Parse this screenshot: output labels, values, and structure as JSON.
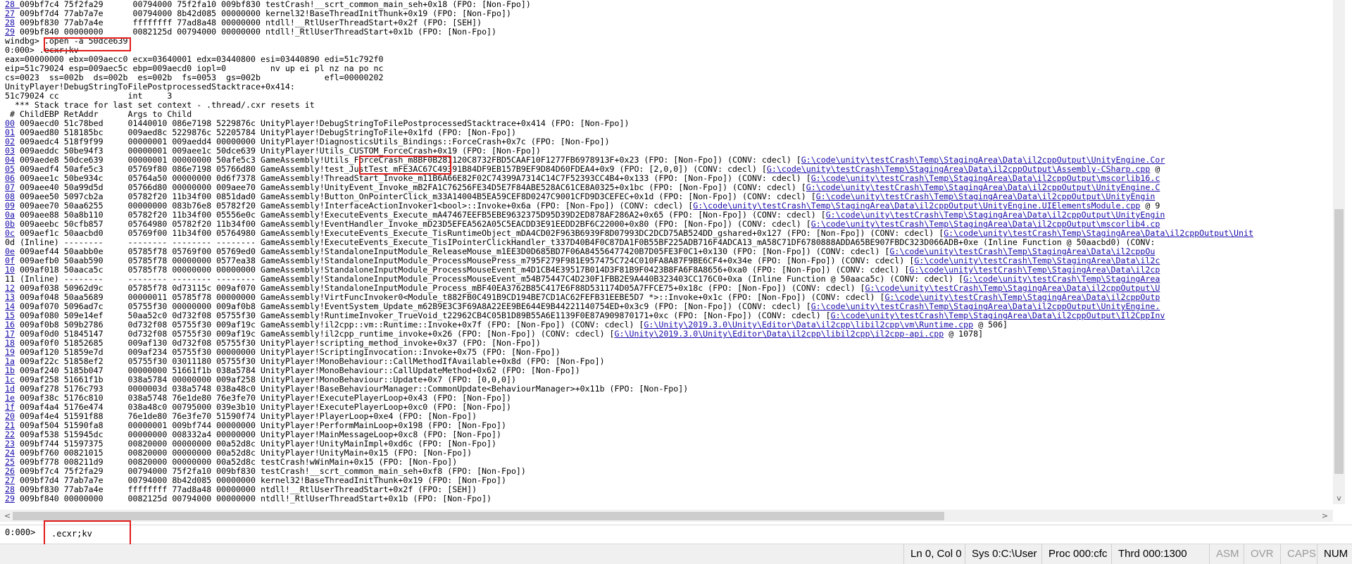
{
  "output_lines": [
    [
      {
        "t": "28 ",
        "l": true
      },
      {
        "t": "009bf7c4 75f2fa29      00794000 75f2fa10 009bf830 testCrash!__scrt_common_main_seh+0x18 (FPO: [Non-Fpo])"
      }
    ],
    [
      {
        "t": "27",
        "l": true
      },
      {
        "t": " 009bf7d4 77ab7a7e      00794000 8b42d085 00000000 kernel32!BaseThreadInitThunk+0x19 (FPO: [Non-Fpo])"
      }
    ],
    [
      {
        "t": "28",
        "l": true
      },
      {
        "t": " 009bf830 77ab7a4e      ffffffff 77ad8a48 00000000 ntdll!__RtlUserThreadStart+0x2f (FPO: [SEH])"
      }
    ],
    [
      {
        "t": "29",
        "l": true
      },
      {
        "t": " 009bf840 00000000      0082125d 00794000 00000000 ntdll!_RtlUserThreadStart+0x1b (FPO: [Non-Fpo])"
      }
    ],
    [
      {
        "t": "windbg> .open -a 50dce639"
      }
    ],
    [
      {
        "t": "0:000> .ecxr;kv"
      }
    ],
    [
      {
        "t": "eax=00000000 ebx=009aecc0 ecx=03640001 edx=03440800 esi=03440890 edi=51c792f0"
      }
    ],
    [
      {
        "t": "eip=51c79024 esp=009aec5c ebp=009aecd0 iopl=0         nv up ei pl nz na po nc"
      }
    ],
    [
      {
        "t": "cs=0023  ss=002b  ds=002b  es=002b  fs=0053  gs=002b             efl=00000202"
      }
    ],
    [
      {
        "t": "UnityPlayer!DebugStringToFilePostprocessedStacktrace+0x414:"
      }
    ],
    [
      {
        "t": "51c79024 cc              int     3"
      }
    ],
    [
      {
        "t": "  *** Stack trace for last set context - .thread/.cxr resets it"
      }
    ],
    [
      {
        "t": " # ChildEBP RetAddr      Args to Child"
      }
    ],
    [
      {
        "t": "00",
        "l": true
      },
      {
        "t": " 009aecd0 51c78bed     01440010 086e7198 5229876c UnityPlayer!DebugStringToFilePostprocessedStacktrace+0x414 (FPO: [Non-Fpo])"
      }
    ],
    [
      {
        "t": "01",
        "l": true
      },
      {
        "t": " 009aed80 518185bc     009aed8c 5229876c 52205784 UnityPlayer!DebugStringToFile+0x1fd (FPO: [Non-Fpo])"
      }
    ],
    [
      {
        "t": "02",
        "l": true
      },
      {
        "t": " 009aedc4 518f9f99     00000001 009aedd4 00000000 UnityPlayer!DiagnosticsUtils_Bindings::ForceCrash+0x7c (FPO: [Non-Fpo])"
      }
    ],
    [
      {
        "t": "03",
        "l": true
      },
      {
        "t": " 009aeddc 50be94f3     00000001 009aee1c 50dce639 UnityPlayer!Utils_CUSTOM_ForceCrash+0x19 (FPO: [Non-Fpo])"
      }
    ],
    [
      {
        "t": "04",
        "l": true
      },
      {
        "t": " 009aede8 50dce639     00000001 00000000 50afe5c3 GameAssembly!Utils_ForceCrash_m8BF0B281120C8732FBD5CAAF10F1277FB6978913F+0x23 (FPO: [Non-Fpo]) (CONV: cdecl) ["
      },
      {
        "t": "G:\\code\\unity\\testCrash\\Temp\\StagingArea\\Data\\il2cppOutput\\UnityEngine.Cor",
        "l": true
      }
    ],
    [
      {
        "t": "05",
        "l": true
      },
      {
        "t": " 009aedf4 50afe5c3     05769f80 086e7198 05766d80 GameAssembly!test_JustTest_mFE3AC67C49391B84DF9EB157B9EF9D84D60FDEA4+0x9 (FPO: [2,0,0]) (CONV: cdecl) ["
      },
      {
        "t": "G:\\code\\unity\\testCrash\\Temp\\StagingArea\\Data\\il2cppOutput\\Assembly-CSharp.cpp",
        "l": true
      },
      {
        "t": " @"
      }
    ],
    [
      {
        "t": "06",
        "l": true
      },
      {
        "t": " 009aee1c 50be934c     05764a50 00000000 0d6f7378 GameAssembly!ThreadStart_Invoke_m11B6A66E82F02C74399A7314C14C7F52393CC4B4+0x133 (FPO: [Non-Fpo]) (CONV: cdecl) ["
      },
      {
        "t": "G:\\code\\unity\\testCrash\\Temp\\StagingArea\\Data\\il2cppOutput\\mscorlib16.c",
        "l": true
      }
    ],
    [
      {
        "t": "07",
        "l": true
      },
      {
        "t": " 009aee40 50a99d5d     05766d80 00000000 009aee70 GameAssembly!UnityEvent_Invoke_mB2FA1C76256FE34D5E7F84ABE528AC61CE8A0325+0x1bc (FPO: [Non-Fpo]) (CONV: cdecl) ["
      },
      {
        "t": "G:\\code\\unity\\testCrash\\Temp\\StagingArea\\Data\\il2cppOutput\\UnityEngine.C",
        "l": true
      }
    ],
    [
      {
        "t": "08",
        "l": true
      },
      {
        "t": " 009aee50 5097cb2a     05782f20 11b34f00 0851dad0 GameAssembly!Button_OnPointerClick_m33A14004B5EA59CEF8D0247C9001CFD9D3CEFEC+0x1d (FPO: [Non-Fpo]) (CONV: cdecl) ["
      },
      {
        "t": "G:\\code\\unity\\testCrash\\Temp\\StagingArea\\Data\\il2cppOutput\\UnityEngin",
        "l": true
      }
    ],
    [
      {
        "t": "09",
        "l": true
      },
      {
        "t": " 009aee70 50aa6255     00000000 083b76e8 05782f20 GameAssembly!InterfaceActionInvoker1<bool>::Invoke+0x6a (FPO: [Non-Fpo]) (CONV: cdecl) ["
      },
      {
        "t": "G:\\code\\unity\\testCrash\\Temp\\StagingArea\\Data\\il2cppOutput\\UnityEngine.UIElementsModule.cpp",
        "l": true
      },
      {
        "t": " @ 9"
      }
    ],
    [
      {
        "t": "0a",
        "l": true
      },
      {
        "t": " 009aee88 50a8b110     05782f20 11b34f00 05556e0c GameAssembly!ExecuteEvents_Execute_mA47467EEFB5EBE9632375D95D39D2ED878AF286A2+0x65 (FPO: [Non-Fpo]) (CONV: cdecl) ["
      },
      {
        "t": "G:\\code\\unity\\testCrash\\Temp\\StagingArea\\Data\\il2cppOutput\\UnityEngin",
        "l": true
      }
    ],
    [
      {
        "t": "0b",
        "l": true
      },
      {
        "t": " 009aeebc 50cfb857     05764980 05782f20 11b34f00 GameAssembly!EventHandler_Invoke_mD23D5EFEA562A05C5EACDD3E91EEDD2BF6C22000+0x80 (FPO: [Non-Fpo]) (CONV: cdecl) ["
      },
      {
        "t": "G:\\code\\unity\\testCrash\\Temp\\StagingArea\\Data\\il2cppOutput\\mscorlib4.cp",
        "l": true
      }
    ],
    [
      {
        "t": "0c",
        "l": true
      },
      {
        "t": " 009aef1c 50aacbd0     05769f00 11b34f00 05764980 GameAssembly!ExecuteEvents_Execute_TisRuntimeObject_mDA4CD02F963B6939F8D07993DC2DCD75AB524DD_gshared+0x127 (FPO: [Non-Fpo]) (CONV: cdecl) ["
      },
      {
        "t": "G:\\code\\unity\\testCrash\\Temp\\StagingArea\\Data\\il2cppOutput\\Unit",
        "l": true
      }
    ],
    [
      {
        "t": "0d (Inline) --------     -------- -------- -------- GameAssembly!ExecuteEvents_Execute_TisIPointerClickHandler_t337D40B4F0C87DA1F0B55BF225ADB716F4ADCA13_mA58C71DF6780888ADDA65BE907FBDC323D066ADB+0xe (Inline Function @ 50aacbd0) (CONV:"
      }
    ],
    [
      {
        "t": "0e",
        "l": true
      },
      {
        "t": " 009aef44 50aabb0e     05785f78 05769f00 05769ed0 GameAssembly!StandaloneInputModule_ReleaseMouse_m1EE3D0D685BD7F06A84556477420B7D05FE3F0C1+0x130 (FPO: [Non-Fpo]) (CONV: cdecl) ["
      },
      {
        "t": "G:\\code\\unity\\testCrash\\Temp\\StagingArea\\Data\\il2cppOu",
        "l": true
      }
    ],
    [
      {
        "t": "0f",
        "l": true
      },
      {
        "t": " 009aefb0 50aab590     05785f78 00000000 0577ea38 GameAssembly!StandaloneInputModule_ProcessMousePress_m795F279F981E957475C724C010FA8A87F9BE6CF4+0x34e (FPO: [Non-Fpo]) (CONV: cdecl) ["
      },
      {
        "t": "G:\\code\\unity\\testCrash\\Temp\\StagingArea\\Data\\il2c",
        "l": true
      }
    ],
    [
      {
        "t": "10",
        "l": true
      },
      {
        "t": " 009af018 50aaca5c     05785f78 00000000 00000000 GameAssembly!StandaloneInputModule_ProcessMouseEvent_m4D1CB4E39517B014D3F81B9F0423B8FA6F8A8656+0xa0 (FPO: [Non-Fpo]) (CONV: cdecl) ["
      },
      {
        "t": "G:\\code\\unity\\testCrash\\Temp\\StagingArea\\Data\\il2cp",
        "l": true
      }
    ],
    [
      {
        "t": "11 (Inline) --------     -------- -------- -------- GameAssembly!StandaloneInputModule_ProcessMouseEvent_m54B75447C4D230F1FBB2E9A440B323403CC176C0+0xa (Inline Function @ 50aaca5c) (CONV: cdecl) ["
      },
      {
        "t": "G:\\code\\unity\\testCrash\\Temp\\StagingArea",
        "l": true
      }
    ],
    [
      {
        "t": "12",
        "l": true
      },
      {
        "t": " 009af038 50962d9c     05785f78 0d73115c 009af070 GameAssembly!StandaloneInputModule_Process_mBF40EA3762B85C417E6F88D531174D05A7FFCE75+0x18c (FPO: [Non-Fpo]) (CONV: cdecl) ["
      },
      {
        "t": "G:\\code\\unity\\testCrash\\Temp\\StagingArea\\Data\\il2cppOutput\\U",
        "l": true
      }
    ],
    [
      {
        "t": "13",
        "l": true
      },
      {
        "t": " 009af048 50aa5689     00000011 05785f78 00000000 GameAssembly!VirtFuncInvoker0<Module_t882FB0C491B9CD194BE7CD1AC62FEFB31EEBE5D7 *>::Invoke+0x1c (FPO: [Non-Fpo]) (CONV: cdecl) ["
      },
      {
        "t": "G:\\code\\unity\\testCrash\\Temp\\StagingArea\\Data\\il2cppOutp",
        "l": true
      }
    ],
    [
      {
        "t": "14",
        "l": true
      },
      {
        "t": " 009af070 5096ad7c     05755f30 00000000 009af0b8 GameAssembly!EventSystem_Update_m62B9E3C3F69A8A22EE9BE644E9B44221140754ED+0x3c9 (FPO: [Non-Fpo]) (CONV: cdecl) ["
      },
      {
        "t": "G:\\code\\unity\\testCrash\\Temp\\StagingArea\\Data\\il2cppOutput\\UnityEngine.",
        "l": true
      }
    ],
    [
      {
        "t": "15",
        "l": true
      },
      {
        "t": " 009af080 509e14ef     50aa52c0 0d732f08 05755f30 GameAssembly!RuntimeInvoker_TrueVoid_t22962CB4C05B1D89B55A6E1139F0E87A909870171+0xc (FPO: [Non-Fpo]) (CONV: cdecl) ["
      },
      {
        "t": "G:\\code\\unity\\testCrash\\Temp\\StagingArea\\Data\\il2cppOutput\\Il2CppInv",
        "l": true
      }
    ],
    [
      {
        "t": "16",
        "l": true
      },
      {
        "t": " 009af0b8 509b2786     0d732f08 05755f30 009af19c GameAssembly!il2cpp::vm::Runtime::Invoke+0x7f (FPO: [Non-Fpo]) (CONV: cdecl) ["
      },
      {
        "t": "G:\\Unity\\2019.3.0\\Unity\\Editor\\Data\\il2cpp\\libil2cpp\\vm\\Runtime.cpp",
        "l": true
      },
      {
        "t": " @ 506]"
      }
    ],
    [
      {
        "t": "17",
        "l": true
      },
      {
        "t": " 009af0d0 51845147     0d732f08 05755f30 009af19c GameAssembly!il2cpp_runtime_invoke+0x26 (FPO: [Non-Fpo]) (CONV: cdecl) ["
      },
      {
        "t": "G:\\Unity\\2019.3.0\\Unity\\Editor\\Data\\il2cpp\\libil2cpp\\il2cpp-api.cpp",
        "l": true
      },
      {
        "t": " @ 1078]"
      }
    ],
    [
      {
        "t": "18",
        "l": true
      },
      {
        "t": " 009af0f0 51852685     009af130 0d732f08 05755f30 UnityPlayer!scripting_method_invoke+0x37 (FPO: [Non-Fpo])"
      }
    ],
    [
      {
        "t": "19",
        "l": true
      },
      {
        "t": " 009af120 51859e7d     009af234 05755f30 00000000 UnityPlayer!ScriptingInvocation::Invoke+0x75 (FPO: [Non-Fpo])"
      }
    ],
    [
      {
        "t": "1a",
        "l": true
      },
      {
        "t": " 009af22c 51858ef2     05755f30 03011180 05755f30 UnityPlayer!MonoBehaviour::CallMethodIfAvailable+0x8d (FPO: [Non-Fpo])"
      }
    ],
    [
      {
        "t": "1b",
        "l": true
      },
      {
        "t": " 009af240 5185b047     00000000 51661f1b 038a5784 UnityPlayer!MonoBehaviour::CallUpdateMethod+0x62 (FPO: [Non-Fpo])"
      }
    ],
    [
      {
        "t": "1c",
        "l": true
      },
      {
        "t": " 009af258 51661f1b     038a5784 00000000 009af258 UnityPlayer!MonoBehaviour::Update+0x7 (FPO: [0,0,0])"
      }
    ],
    [
      {
        "t": "1d",
        "l": true
      },
      {
        "t": " 009af278 5176c793     0000003d 038a5748 038a48c0 UnityPlayer!BaseBehaviourManager::CommonUpdate<BehaviourManager>+0x11b (FPO: [Non-Fpo])"
      }
    ],
    [
      {
        "t": "1e",
        "l": true
      },
      {
        "t": " 009af38c 5176c810     038a5748 76e1de80 76e3fe70 UnityPlayer!ExecutePlayerLoop+0x43 (FPO: [Non-Fpo])"
      }
    ],
    [
      {
        "t": "1f",
        "l": true
      },
      {
        "t": " 009af4a4 5176e474     038a48c0 00795000 039e3b10 UnityPlayer!ExecutePlayerLoop+0xc0 (FPO: [Non-Fpo])"
      }
    ],
    [
      {
        "t": "20",
        "l": true
      },
      {
        "t": " 009af4e4 51591f88     76e1de80 76e3fe70 51590f74 UnityPlayer!PlayerLoop+0xe4 (FPO: [Non-Fpo])"
      }
    ],
    [
      {
        "t": "21",
        "l": true
      },
      {
        "t": " 009af504 51590fa8     00000001 009bf744 00000000 UnityPlayer!PerformMainLoop+0x198 (FPO: [Non-Fpo])"
      }
    ],
    [
      {
        "t": "22",
        "l": true
      },
      {
        "t": " 009af538 515945dc     00000000 008332a4 00000000 UnityPlayer!MainMessageLoop+0xc8 (FPO: [Non-Fpo])"
      }
    ],
    [
      {
        "t": "23",
        "l": true
      },
      {
        "t": " 009bf744 51597375     00820000 00000000 00a52d8c UnityPlayer!UnityMainImpl+0xd6c (FPO: [Non-Fpo])"
      }
    ],
    [
      {
        "t": "24",
        "l": true
      },
      {
        "t": " 009bf760 00821015     00820000 00000000 00a52d8c UnityPlayer!UnityMain+0x15 (FPO: [Non-Fpo])"
      }
    ],
    [
      {
        "t": "25",
        "l": true
      },
      {
        "t": " 009bf778 008211d9     00820000 00000000 00a52d8c testCrash!wWinMain+0x15 (FPO: [Non-Fpo])"
      }
    ],
    [
      {
        "t": "26",
        "l": true
      },
      {
        "t": " 009bf7c4 75f2fa29     00794000 75f2fa10 009bf830 testCrash!__scrt_common_main_seh+0xf8 (FPO: [Non-Fpo])"
      }
    ],
    [
      {
        "t": "27",
        "l": true
      },
      {
        "t": " 009bf7d4 77ab7a7e     00794000 8b42d085 00000000 kernel32!BaseThreadInitThunk+0x19 (FPO: [Non-Fpo])"
      }
    ],
    [
      {
        "t": "28",
        "l": true
      },
      {
        "t": " 009bf830 77ab7a4e     ffffffff 77ad8a48 00000000 ntdll!__RtlUserThreadStart+0x2f (FPO: [SEH])"
      }
    ],
    [
      {
        "t": "29",
        "l": true
      },
      {
        "t": " 009bf840 00000000     0082125d 00794000 00000000 ntdll!_RtlUserThreadStart+0x1b (FPO: [Non-Fpo])"
      }
    ]
  ],
  "command": {
    "prompt": "0:000>",
    "value": ".ecxr;kv"
  },
  "scroll_arrows": {
    "left": "<",
    "right": ">",
    "down": "v"
  },
  "status": {
    "position": "Ln 0, Col 0",
    "sys": "Sys 0:C:\\User",
    "proc": "Proc 000:cfc",
    "thrd": "Thrd 000:1300",
    "asm": "ASM",
    "ovr": "OVR",
    "caps": "CAPS",
    "num": "NUM"
  },
  "colors": {
    "link": "#1a0dab",
    "highlight_box": "#e11b1b",
    "status_bar": "#f0f0f0",
    "dim_status": "#9b9b9b"
  }
}
